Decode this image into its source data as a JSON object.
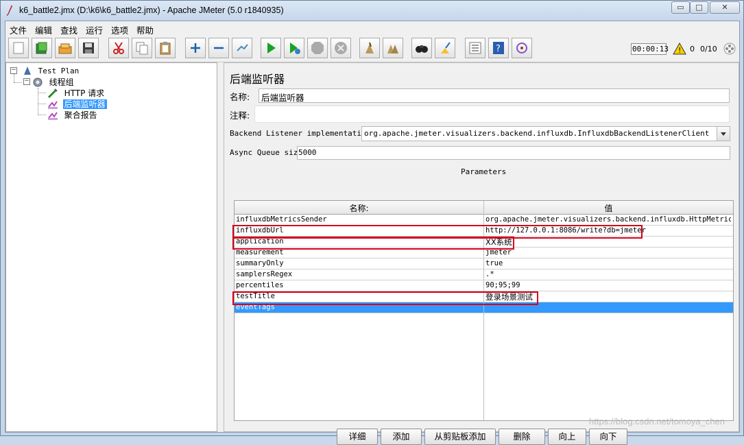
{
  "window": {
    "title": "k6_battle2.jmx (D:\\k6\\k6_battle2.jmx) - Apache JMeter (5.0 r1840935)",
    "minimize": "▭",
    "maximize": "□",
    "close": "✕"
  },
  "menu": [
    "文件",
    "编辑",
    "查找",
    "运行",
    "选项",
    "帮助"
  ],
  "toolbar": {
    "icons": [
      "new-icon",
      "templates-icon",
      "open-icon",
      "save-icon",
      "cut-icon",
      "copy-icon",
      "paste-icon",
      "expand-icon",
      "collapse-icon",
      "toggle-icon",
      "start-icon",
      "start-no-pause-icon",
      "stop-icon",
      "shutdown-icon",
      "clear-icon",
      "clear-all-icon",
      "search-icon",
      "reset-search-icon",
      "function-helper-icon",
      "help-icon",
      "remote-icon"
    ],
    "timer": "00:00:13",
    "warnings": "0",
    "threads": "0/10"
  },
  "tree": {
    "root": "Test Plan",
    "thread_group": "线程组",
    "items": [
      "HTTP 请求",
      "后端监听器",
      "聚合报告"
    ]
  },
  "panel": {
    "heading": "后端监听器",
    "name_label": "名称:",
    "name_value": "后端监听器",
    "comment_label": "注释:",
    "comment_value": "",
    "impl_label": "Backend Listener implementation",
    "impl_value": "org.apache.jmeter.visualizers.backend.influxdb.InfluxdbBackendListenerClient",
    "queue_label": "Async Queue size",
    "queue_value": "5000",
    "params_title": "Parameters",
    "col_name": "名称:",
    "col_value": "值"
  },
  "params": [
    {
      "name": "influxdbMetricsSender",
      "value": "org.apache.jmeter.visualizers.backend.influxdb.HttpMetric..."
    },
    {
      "name": "influxdbUrl",
      "value": "http://127.0.0.1:8086/write?db=jmeter"
    },
    {
      "name": "application",
      "value": "XX系统"
    },
    {
      "name": "measurement",
      "value": "jmeter"
    },
    {
      "name": "summaryOnly",
      "value": "true"
    },
    {
      "name": "samplersRegex",
      "value": ".*"
    },
    {
      "name": "percentiles",
      "value": "90;95;99"
    },
    {
      "name": "testTitle",
      "value": "登录场景测试"
    },
    {
      "name": "eventTags",
      "value": ""
    }
  ],
  "buttons": [
    "详细",
    "添加",
    "从剪贴板添加",
    "删除",
    "向上",
    "向下"
  ],
  "watermark": "https://blog.csdn.net/tomoya_chen",
  "colors": {
    "selection": "#3399ff",
    "highlight": "#d4001a"
  }
}
